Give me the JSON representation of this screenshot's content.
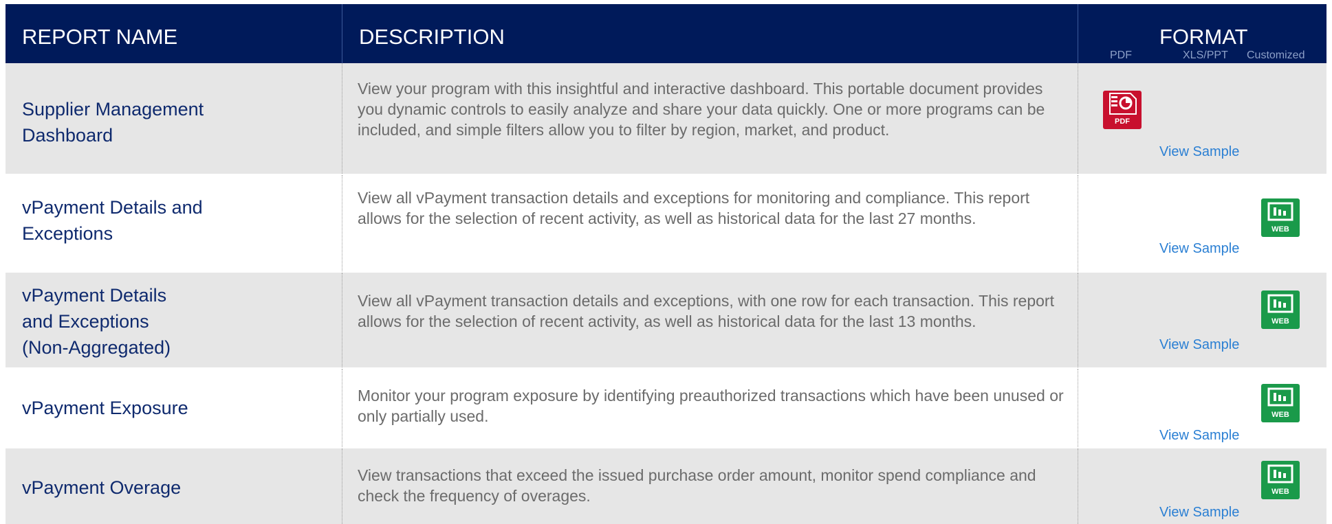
{
  "header": {
    "report_name": "REPORT NAME",
    "description": "DESCRIPTION",
    "format": "FORMAT",
    "format_subcols": [
      "PDF",
      "XLS/PPT",
      "Customized"
    ]
  },
  "rows": [
    {
      "name": "Supplier Management\nDashboard",
      "description": "View your program with this insightful and interactive dashboard. This portable document provides you dynamic controls to easily analyze and share your data quickly. One or more programs can be included, and simple filters allow you to filter by region, market, and product.",
      "format_icon": "pdf-icon",
      "icon_label": "PDF",
      "sample": "View Sample"
    },
    {
      "name": "vPayment Details and\nExceptions",
      "description": "View all vPayment transaction details and exceptions for monitoring and compliance. This report allows for the selection of recent activity, as well as historical data for the last 27 months.",
      "format_icon": "web-icon",
      "icon_label": "WEB",
      "sample": "View Sample"
    },
    {
      "name": "vPayment Details\nand Exceptions\n (Non-Aggregated)",
      "description": "View all vPayment transaction details and exceptions, with one row for each transaction. This report allows for the selection of recent activity, as well as historical data for the last 13 months.",
      "format_icon": "web-icon",
      "icon_label": "WEB",
      "sample": "View Sample"
    },
    {
      "name": "vPayment Exposure",
      "description": "Monitor your program exposure by identifying preauthorized transactions which have been unused or only partially used.",
      "format_icon": "web-icon",
      "icon_label": "WEB",
      "sample": "View Sample"
    },
    {
      "name": "vPayment Overage",
      "description": "View transactions that exceed the issued purchase order amount, monitor spend compliance and check the frequency of overages.",
      "format_icon": "web-icon",
      "icon_label": "WEB",
      "sample": "View Sample"
    }
  ],
  "colors": {
    "header_bg": "#001a5a",
    "row_shaded": "#e6e6e6",
    "name_text": "#0f2a6e",
    "link": "#2a7fd3",
    "pdf": "#c8102e",
    "web": "#1a9a4a"
  }
}
